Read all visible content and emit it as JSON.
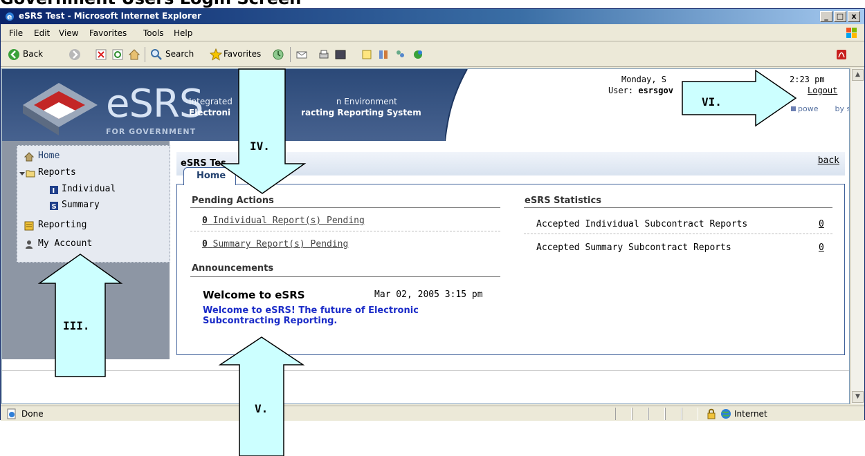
{
  "page_heading": "Government Users Login Screen",
  "window": {
    "title": "eSRS Test - Microsoft Internet Explorer",
    "controls": {
      "minimize": "_",
      "maximize": "□",
      "close": "x"
    }
  },
  "menu": [
    "File",
    "Edit",
    "View",
    "Favorites",
    "Tools",
    "Help"
  ],
  "toolbar": {
    "back": "Back",
    "search": "Search",
    "favorites": "Favorites"
  },
  "header": {
    "brand": "eSRS",
    "brand_sub": "FOR GOVERNMENT",
    "line1": "Integrated",
    "line1_end": "n Environment",
    "line2": "Electroni",
    "line2_end": "racting Reporting System",
    "date_prefix": "Monday, S",
    "time_suffix": "2:23 pm",
    "user_prefix": "User:",
    "user_name": "esrsgov",
    "logout": "Logout",
    "powered_prefix": "powe",
    "powered_suffix": "by symplicity"
  },
  "nav": [
    {
      "label": "Home",
      "icon": "home-icon"
    },
    {
      "label": "Reports",
      "icon": "folder-icon"
    },
    {
      "label": "Individual",
      "icon": "individual-report-icon"
    },
    {
      "label": "Summary",
      "icon": "summary-report-icon"
    },
    {
      "label": "Reporting",
      "icon": "reporting-icon"
    },
    {
      "label": "My Account",
      "icon": "user-icon"
    }
  ],
  "main": {
    "title": "eSRS Tes",
    "back": "back",
    "tab": "Home",
    "pending": {
      "heading": "Pending Actions",
      "items": [
        {
          "count": "0",
          "label": "Individual Report(s) Pending"
        },
        {
          "count": "0",
          "label": "Summary Report(s) Pending"
        }
      ]
    },
    "stats": {
      "heading": "eSRS Statistics",
      "rows": [
        {
          "label": "Accepted Individual Subcontract Reports",
          "value": "0"
        },
        {
          "label": "Accepted Summary Subcontract Reports",
          "value": "0"
        }
      ]
    },
    "announcements": {
      "heading": "Announcements",
      "title": "Welcome to eSRS",
      "date": "Mar 02, 2005 3:15 pm",
      "body": "Welcome to eSRS! The future of Electronic Subcontracting Reporting."
    }
  },
  "status": {
    "left": "Done",
    "zone": "Internet"
  },
  "callouts": {
    "III": "III.",
    "IV": "IV.",
    "V": "V.",
    "VI": "VI."
  },
  "colors": {
    "callout_fill": "#ccffff",
    "header_blue": "#2b4978",
    "link_blue": "#1b2cc8"
  }
}
